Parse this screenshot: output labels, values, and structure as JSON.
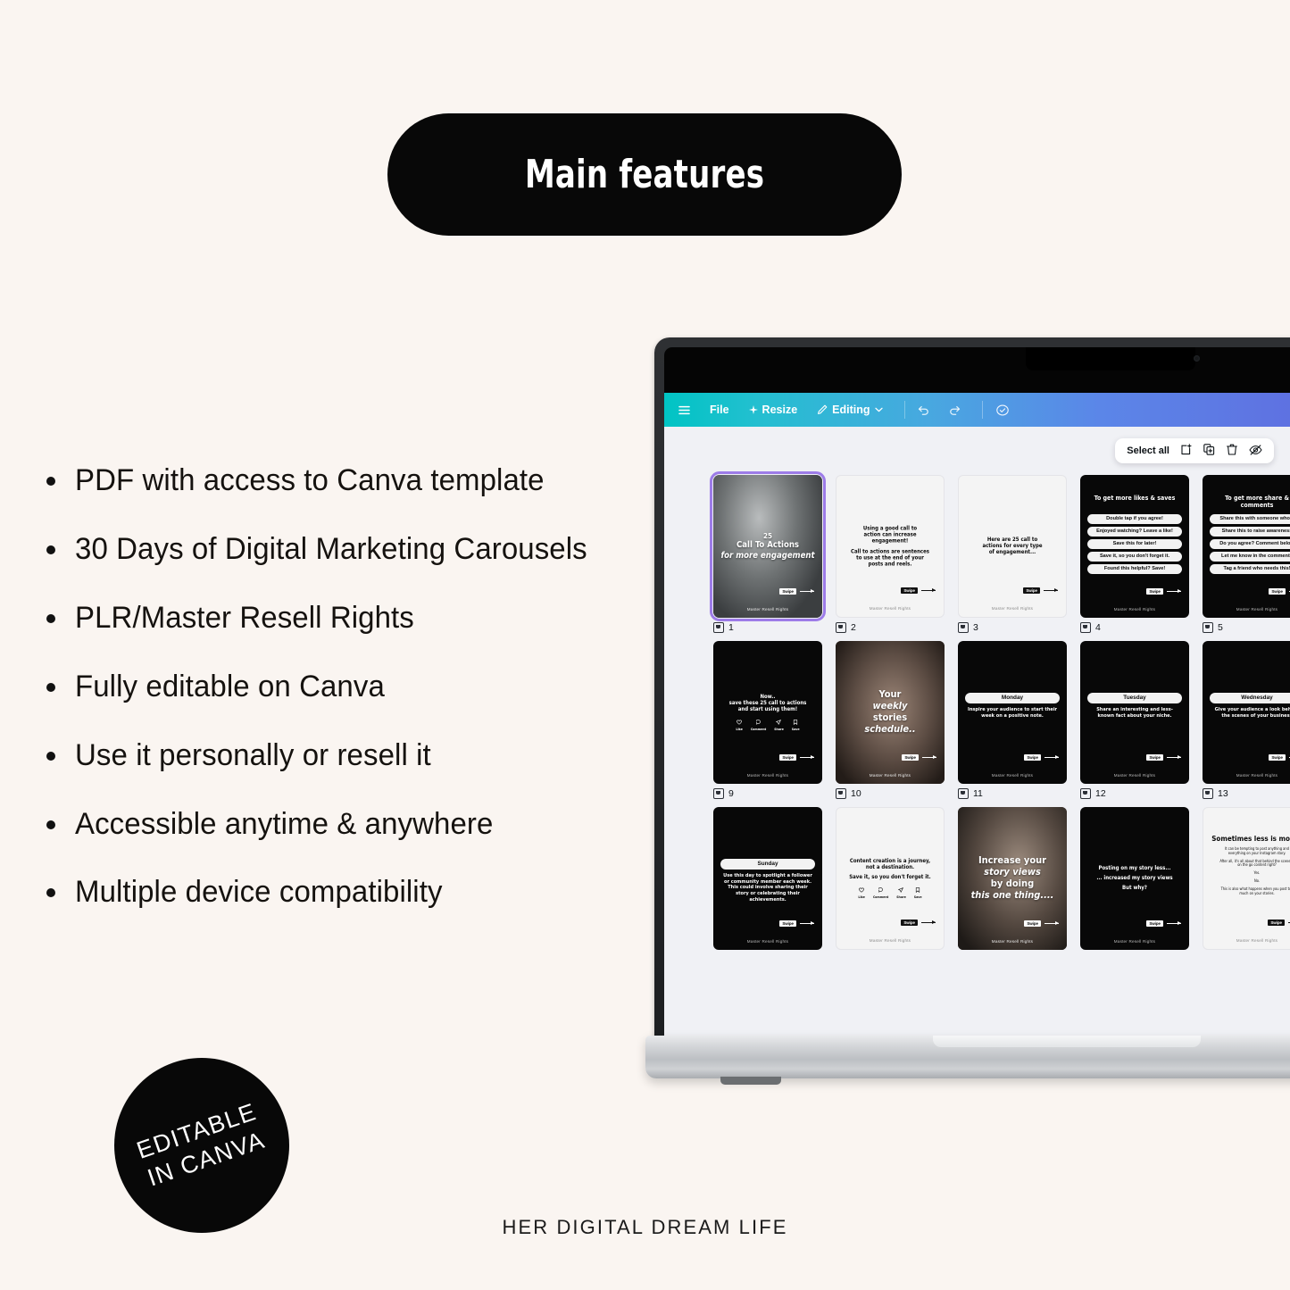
{
  "theme": {
    "background": "#faf5f1",
    "ink": "#15120f",
    "badge_bg": "#080808",
    "selection": "#9d7ce8",
    "canva_gradient_start": "#00c4c4",
    "canva_gradient_end": "#5f6ee0"
  },
  "header": {
    "title": "Main features"
  },
  "features": {
    "items": [
      "PDF with access to Canva template",
      "30 Days of Digital Marketing Carousels",
      "PLR/Master Resell Rights",
      "Fully editable on Canva",
      "Use it personally or resell it",
      "Accessible anytime & anywhere",
      "Multiple device compatibility"
    ]
  },
  "badge": {
    "line1": "EDITABLE",
    "line2": "IN CANVA"
  },
  "footer": {
    "brand": "HER DIGITAL DREAM LIFE"
  },
  "canva": {
    "toolbar": {
      "menu_icon": "hamburger-icon",
      "file": "File",
      "resize": "Resize",
      "resize_icon": "sparkle-icon",
      "editing": "Editing",
      "editing_icon": "pencil-icon",
      "chevron_icon": "chevron-down-icon",
      "undo_icon": "undo-icon",
      "redo_icon": "redo-icon",
      "cloud_icon": "cloud-check-icon"
    },
    "selection_toolbar": {
      "select_all": "Select all",
      "icons": [
        "add-page-icon",
        "duplicate-page-icon",
        "delete-page-icon",
        "hide-page-icon"
      ]
    },
    "handle": "Master Resell Rights",
    "brand_tag": "Swipe",
    "slides": [
      {
        "page": "1",
        "kind": "photo",
        "photo": "ph1",
        "selected": true,
        "title_lines": [
          "25",
          "Call To Actions",
          "for more engagement"
        ]
      },
      {
        "page": "2",
        "kind": "light",
        "body_lines": [
          "Using a good call to",
          "action can increase",
          "engagement!",
          "",
          "Call to actions are sentences",
          "to use at the end of your",
          "posts and reels."
        ]
      },
      {
        "page": "3",
        "kind": "light",
        "body_lines": [
          "Here are 25 call to",
          "actions for every type",
          "of engagement..."
        ]
      },
      {
        "page": "4",
        "kind": "dark",
        "heading": "To get more likes & saves",
        "pills": [
          "Double tap if you agree!",
          "Enjoyed watching? Leave a like!",
          "Save this for later!",
          "Save it, so you don't forget it.",
          "Found this helpful? Save!"
        ]
      },
      {
        "page": "5",
        "kind": "dark",
        "heading": "To get more share & comments",
        "pills": [
          "Share this with someone who...",
          "Share this to raise awareness",
          "Do you agree? Comment below",
          "Let me know in the comments",
          "Tag a friend who needs this!"
        ]
      },
      {
        "page": "9",
        "kind": "dark",
        "body_lines": [
          "Now..",
          "save these 25 call to actions",
          "and start using them!"
        ],
        "icons": [
          "Like",
          "Comment",
          "Share",
          "Save"
        ]
      },
      {
        "page": "10",
        "kind": "photo",
        "photo": "ph10",
        "title_lines": [
          "Your",
          "weekly",
          "stories",
          "schedule.."
        ]
      },
      {
        "page": "11",
        "kind": "dark",
        "day_pill": "Monday",
        "body_lines": [
          "Inspire your audience to start their",
          "week on a positive note."
        ]
      },
      {
        "page": "12",
        "kind": "dark",
        "day_pill": "Tuesday",
        "body_lines": [
          "Share an interesting and less-",
          "known fact about your niche."
        ]
      },
      {
        "page": "13",
        "kind": "dark",
        "day_pill": "Wednesday",
        "body_lines": [
          "Give your audience a look behind",
          "the scenes of your business"
        ]
      },
      {
        "page": "",
        "kind": "dark",
        "day_pill": "Sunday",
        "body_lines": [
          "Use this day to spotlight a follower",
          "or community member each week.",
          "This could involve sharing their",
          "story or celebrating their",
          "achievements."
        ]
      },
      {
        "page": "",
        "kind": "light",
        "body_lines": [
          "Content creation is a journey,",
          "not a destination.",
          "",
          "Save it, so you don't forget it."
        ],
        "icons": [
          "Like",
          "Comment",
          "Share",
          "Save"
        ]
      },
      {
        "page": "",
        "kind": "photo",
        "photo": "ph14",
        "title_lines": [
          "Increase your",
          "story views",
          "by doing",
          "this one thing...."
        ]
      },
      {
        "page": "",
        "kind": "dark",
        "body_lines": [
          "Posting on my story less...",
          "",
          "... increased my story views",
          "",
          "But why?"
        ]
      },
      {
        "page": "",
        "kind": "light",
        "heading": "Sometimes less is more..",
        "body_lines": [
          "It can be tempting to post anything and",
          "everything on your Instagram story.",
          "",
          "After all, it's all about that behind the scenes /",
          "on the go content right?",
          "",
          "Yes.",
          "",
          "No.",
          "",
          "This is also what happens when you post too",
          "much on your stories."
        ]
      }
    ]
  }
}
